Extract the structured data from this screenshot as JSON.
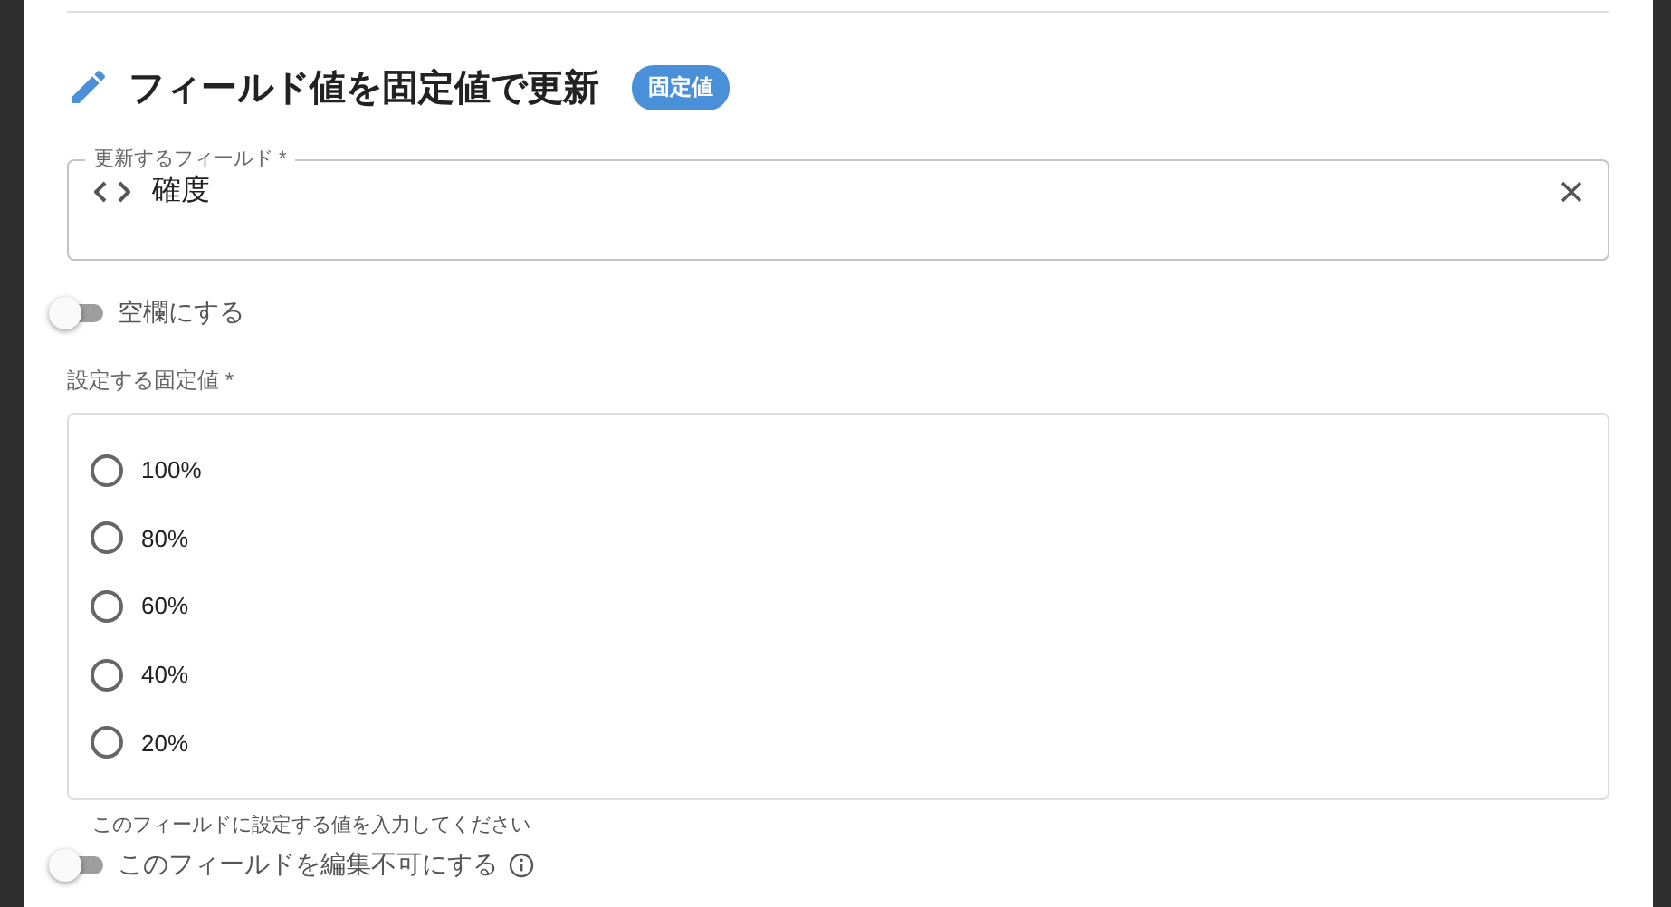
{
  "header": {
    "title": "フィールド値を固定値で更新",
    "badge": "固定値"
  },
  "field_select": {
    "label": "更新するフィールド *",
    "value": "確度"
  },
  "blank_switch": {
    "label": "空欄にする",
    "on": false
  },
  "fixed_value": {
    "label": "設定する固定値 *",
    "helper": "このフィールドに設定する値を入力してください",
    "options": [
      {
        "label": "100%",
        "selected": false
      },
      {
        "label": "80%",
        "selected": false
      },
      {
        "label": "60%",
        "selected": false
      },
      {
        "label": "40%",
        "selected": false
      },
      {
        "label": "20%",
        "selected": false
      }
    ]
  },
  "readonly_switch": {
    "label": "このフィールドを編集不可にする",
    "on": false
  }
}
